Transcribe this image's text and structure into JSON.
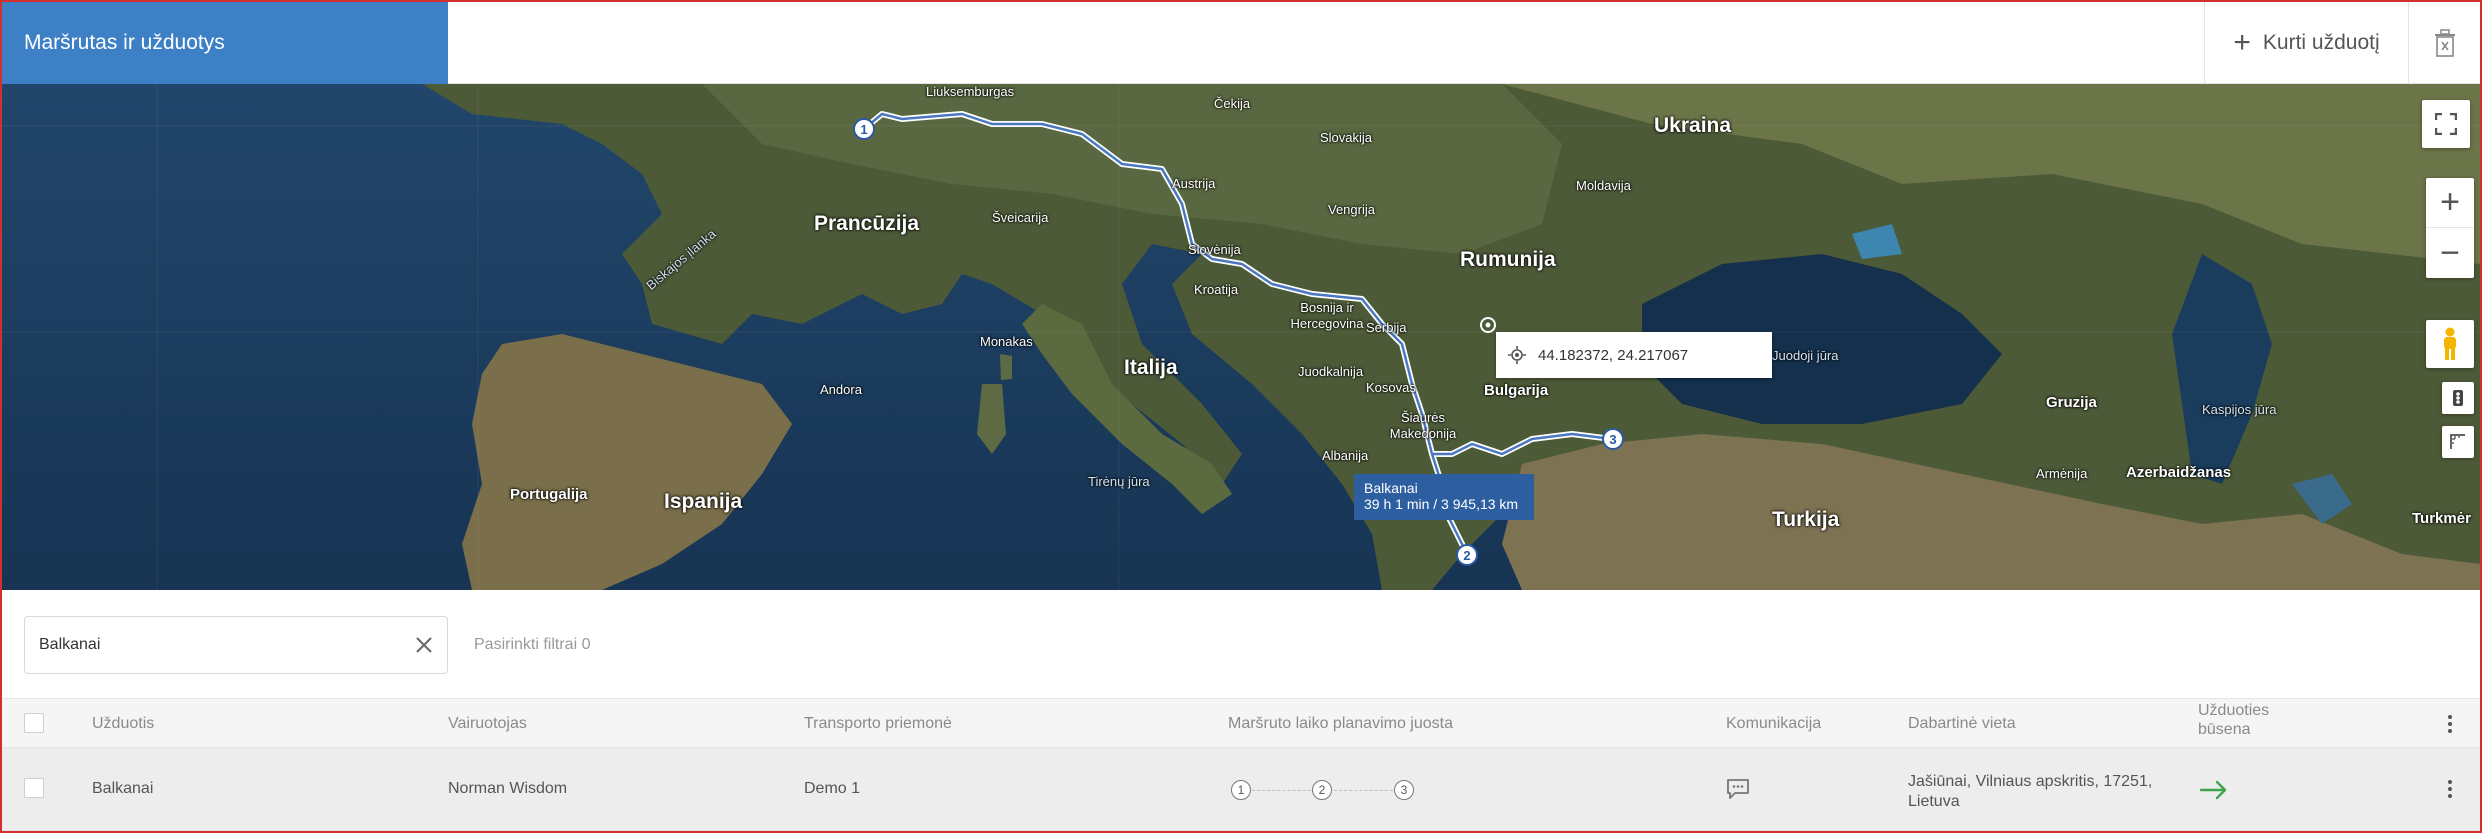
{
  "header": {
    "title": "Maršrutas ir užduotys",
    "create_label": "Kurti užduotį",
    "create_icon": "plus-icon",
    "delete_icon": "trash-icon"
  },
  "map": {
    "labels": {
      "luxembourg": "Liuksemburgas",
      "czech": "Čekija",
      "slovakia": "Slovakija",
      "ukraine": "Ukraina",
      "austria": "Austrija",
      "moldova": "Moldavija",
      "france": "Prancūzija",
      "switzerland": "Šveicarija",
      "hungary": "Vengrija",
      "romania": "Rumunija",
      "slovenia": "Slovėnija",
      "croatia": "Kroatija",
      "bosnia": "Bosnija ir Hercegovina",
      "biscay": "Biskajos įlanka",
      "monaco": "Monakas",
      "serbia": "Serbija",
      "andorra": "Andora",
      "italy": "Italija",
      "montenegro": "Juodkalnija",
      "kosovo": "Kosovas",
      "bulgaria": "Bulgarija",
      "black_sea": "Juodoji jūra",
      "north_macedonia": "Šiaurės Makedonija",
      "georgia": "Gruzija",
      "caspian": "Kaspijos jūra",
      "portugal": "Portugalija",
      "spain": "Ispanija",
      "tyrrhenian": "Tirėnų jūra",
      "albania": "Albanija",
      "armenia": "Armėnija",
      "azerbaijan": "Azerbaidžanas",
      "turkey": "Turkija",
      "turkmenistan": "Turkmėr"
    },
    "markers": [
      "1",
      "2",
      "3"
    ],
    "coordinates": "44.182372, 24.217067",
    "route_tooltip": {
      "name": "Balkanai",
      "summary": "39 h 1 min / 3 945,13 km"
    },
    "controls": {
      "fullscreen_icon": "fullscreen-icon",
      "zoom_in": "+",
      "zoom_out": "−",
      "pegman_icon": "pegman-icon"
    }
  },
  "filter": {
    "search_value": "Balkanai",
    "search_placeholder": "",
    "selected_filters": "Pasirinkti filtrai 0"
  },
  "table": {
    "columns": {
      "task": "Užduotis",
      "driver": "Vairuotojas",
      "vehicle": "Transporto priemonė",
      "timeline": "Maršruto laiko planavimo juosta",
      "communication": "Komunikacija",
      "location": "Dabartinė vieta",
      "status_line1": "Užduoties",
      "status_line2": "būsena"
    },
    "rows": [
      {
        "task": "Balkanai",
        "driver": "Norman Wisdom",
        "vehicle": "Demo 1",
        "steps": [
          "1",
          "2",
          "3"
        ],
        "communication_icon": "chat-icon",
        "location_line1": "Jašiūnai, Vilniaus apskritis, 17251,",
        "location_line2": "Lietuva",
        "status_icon": "arrow-right-icon",
        "status_color": "#3fa34d"
      }
    ]
  }
}
